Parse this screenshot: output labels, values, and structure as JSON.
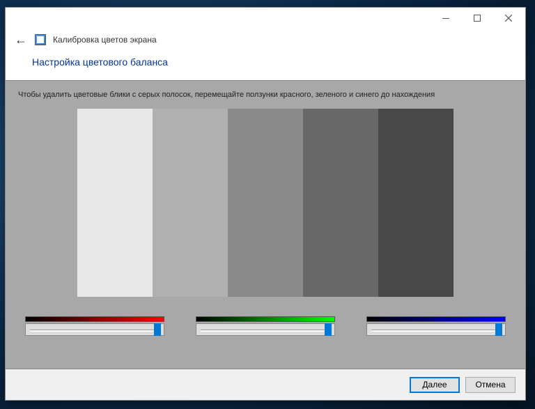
{
  "window": {
    "app_title": "Калибровка цветов экрана",
    "section_title": "Настройка цветового баланса"
  },
  "content": {
    "instruction": "Чтобы удалить цветовые блики с серых полосок, перемещайте ползунки красного, зеленого и синего до нахождения"
  },
  "sliders": {
    "red": {
      "value": 95
    },
    "green": {
      "value": 95
    },
    "blue": {
      "value": 95
    }
  },
  "footer": {
    "next_label": "Далее",
    "cancel_label": "Отмена"
  }
}
